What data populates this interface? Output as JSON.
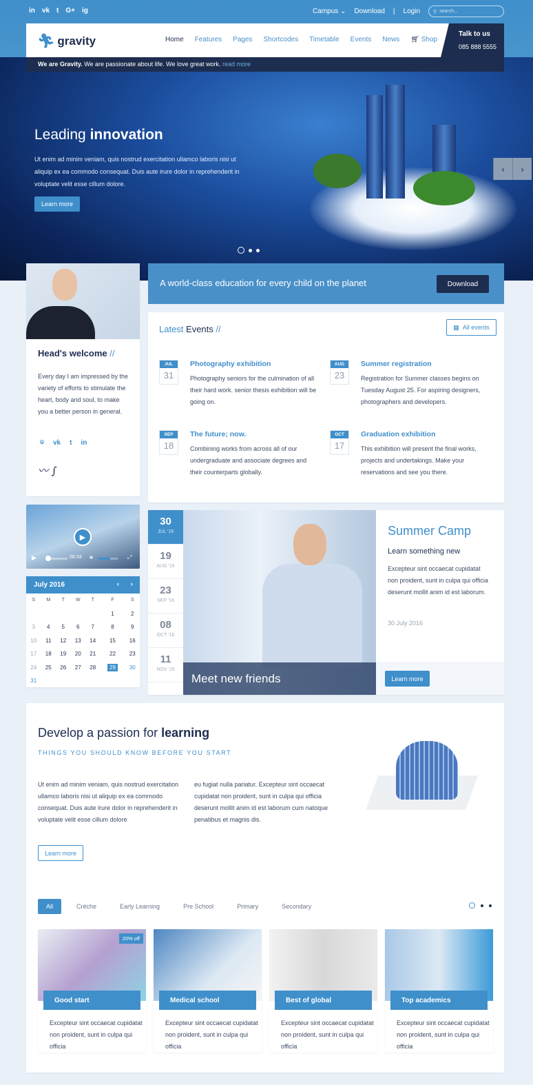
{
  "topbar": {
    "social": [
      "in",
      "vk",
      "t",
      "G+",
      "ig"
    ],
    "links": [
      "Campus",
      "Download",
      "Login"
    ],
    "search_placeholder": "search..."
  },
  "header": {
    "logo": "gravity",
    "nav": [
      "Home",
      "Features",
      "Pages",
      "Shortcodes",
      "Timetable",
      "Events",
      "News",
      "Shop"
    ],
    "talk_title": "Talk to us",
    "phone": "085 888 5555"
  },
  "strip": {
    "bold": "We are Gravity.",
    "text": " We are passionate about life. We love great work. ",
    "link": "read more"
  },
  "hero": {
    "title_light": "Leading ",
    "title_bold": "innovation",
    "text": "Ut enim ad minim veniam, quis nostrud exercitation ullamco laboris nisi ut aliquip ex ea commodo consequat. Duis aute irure dolor in reprehenderit in voluptate velit esse cillum dolore.",
    "button": "Learn more",
    "prev": "‹",
    "next": "›"
  },
  "welcome": {
    "title": "Head's welcome",
    "slash": "//",
    "text": "Every day I am impressed by the variety of efforts to stimulate the heart, body and soul, to make you a better person in general.",
    "signature": "Jona vichosky"
  },
  "banner": {
    "text": "A world-class education for every child on the planet",
    "button": "Download"
  },
  "events": {
    "title_a": "Latest",
    "title_b": " Events",
    "slash": "//",
    "all": "All events",
    "items": [
      {
        "month": "JUL",
        "day": "31",
        "title": "Photography exhibition",
        "text": "Photography seniors for the culmination of all their hard work. senior thesis exhibition will be going on."
      },
      {
        "month": "AUG",
        "day": "23",
        "title": "Summer registration",
        "text": "Registration for Summer classes begins on Tuesday August 25. For aspiring designers, photographers and developers."
      },
      {
        "month": "SEP",
        "day": "18",
        "title": "The future; now.",
        "text": "Combining works from across all of our undergraduate and associate degrees and their counterparts globally."
      },
      {
        "month": "OCT",
        "day": "17",
        "title": "Graduation exhibition",
        "text": "This exhibition will present the final works, projects and undertakings. Make your reservations and see you there."
      }
    ]
  },
  "video": {
    "time": "00:33",
    "progress": 0.05,
    "volume": 0.6
  },
  "calendar": {
    "title": "July 2016",
    "weekdays": [
      "S",
      "M",
      "T",
      "W",
      "T",
      "F",
      "S"
    ],
    "weeks": [
      [
        "",
        "",
        "",
        "",
        "",
        "1",
        "2"
      ],
      [
        "3",
        "4",
        "5",
        "6",
        "7",
        "8",
        "9"
      ],
      [
        "10",
        "11",
        "12",
        "13",
        "14",
        "15",
        "16"
      ],
      [
        "17",
        "18",
        "19",
        "20",
        "21",
        "22",
        "23"
      ],
      [
        "24",
        "25",
        "26",
        "27",
        "28",
        "29",
        "30"
      ],
      [
        "31",
        "",
        "",
        "",
        "",
        "",
        ""
      ]
    ],
    "selected": "29"
  },
  "featured": {
    "dates": [
      {
        "day": "30",
        "label": "JUL '16"
      },
      {
        "day": "19",
        "label": "AUG '16"
      },
      {
        "day": "23",
        "label": "SEP '16"
      },
      {
        "day": "08",
        "label": "OCT '16"
      },
      {
        "day": "11",
        "label": "NOV '16"
      }
    ],
    "caption": "Meet new friends",
    "title": "Summer Camp",
    "subtitle": "Learn something new",
    "text": "Excepteur sint occaecat cupidatat non proident, sunt in culpa qui officia deserunt mollit anim id est laborum.",
    "date": "30 July 2016",
    "button": "Learn more"
  },
  "learning": {
    "title_a": "Develop a passion for ",
    "title_b": "learning",
    "kicker": "THINGS YOU SHOULD KNOW BEFORE YOU START",
    "col1": "Ut enim ad minim veniam, quis nostrud exercitation ullamco laboris nisi ut aliquip ex ea commodo consequat. Duis aute irure dolor in reprehenderit in voluptate velit esse cillum dolore",
    "col2": "eu fugiat nulla pariatur. Excepteur sint occaecat cupidatat non proident, sunt in culpa qui officia deserunt mollit anim id est laborum cum natoque penatibus et magnis dis.",
    "button": "Learn more"
  },
  "programs": {
    "tabs": [
      "All",
      "Crèche",
      "Early Learning",
      "Pre School",
      "Primary",
      "Secondary"
    ],
    "active": "All",
    "badge": "20% off",
    "items": [
      {
        "label": "Good start",
        "text": "Excepteur sint occaecat cupidatat non proident, sunt in culpa qui officia"
      },
      {
        "label": "Medical school",
        "text": "Excepteur sint occaecat cupidatat non proident, sunt in culpa qui officia"
      },
      {
        "label": "Best of global",
        "text": "Excepteur sint occaecat cupidatat non proident, sunt in culpa qui officia"
      },
      {
        "label": "Top academics",
        "text": "Excepteur sint occaecat cupidatat non proident, sunt in culpa qui officia"
      }
    ]
  },
  "colors": {
    "accent": "#3f8fcb",
    "dark": "#1d2d4f",
    "background": "#e9f0f8"
  }
}
